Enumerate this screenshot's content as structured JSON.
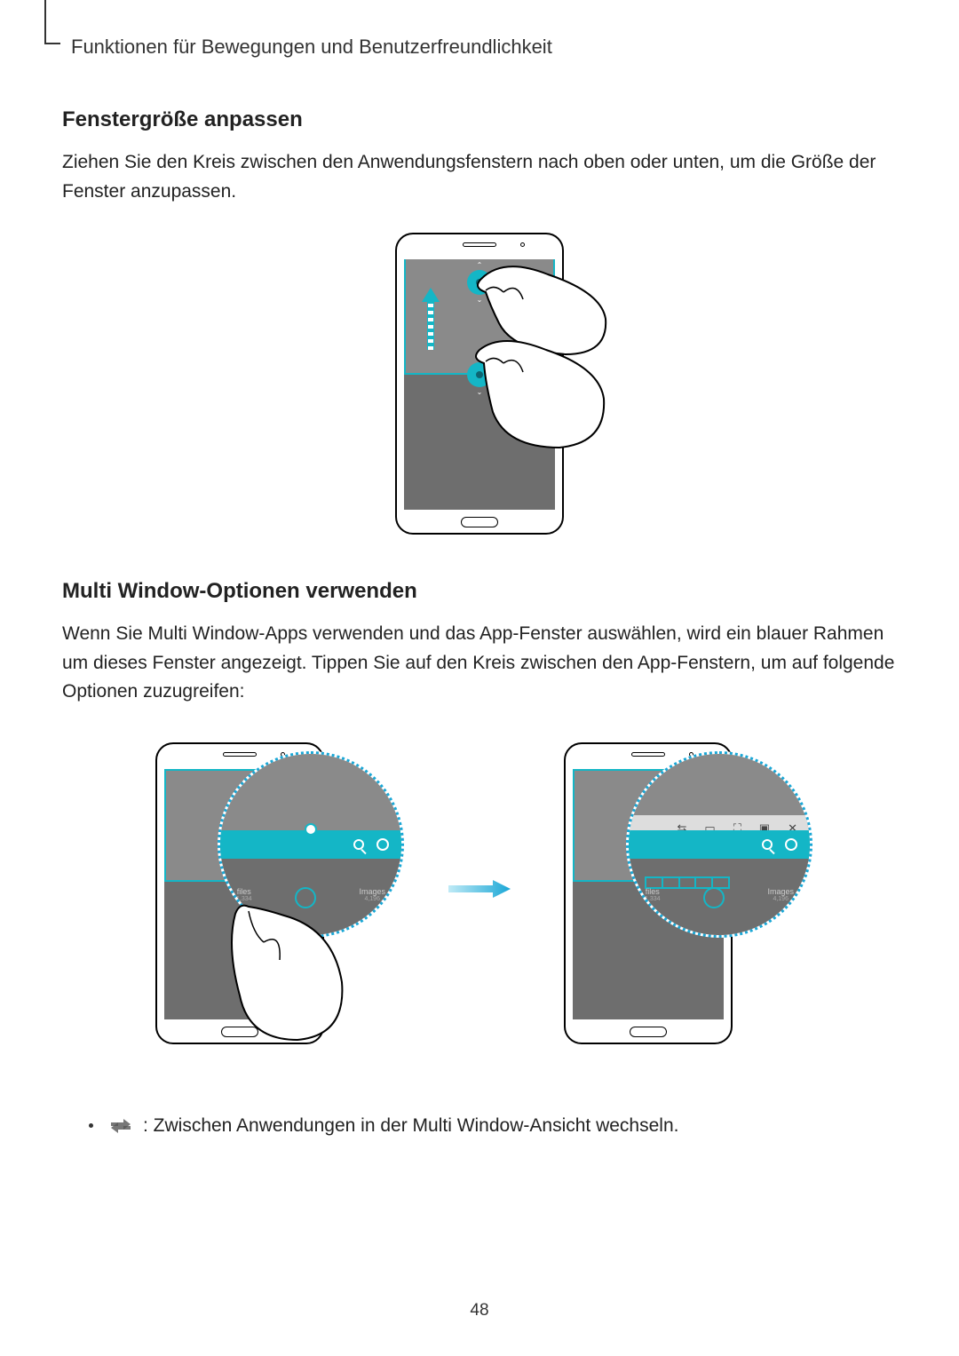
{
  "section_label": "Funktionen für Bewegungen und Benutzerfreundlichkeit",
  "heading1": "Fenstergröße anpassen",
  "para1": "Ziehen Sie den Kreis zwischen den Anwendungsfenstern nach oben oder unten, um die Größe der Fenster anzupassen.",
  "heading2": "Multi Window-Optionen verwenden",
  "para2": "Wenn Sie Multi Window-Apps verwenden und das App-Fenster auswählen, wird ein blauer Rahmen um dieses Fenster angezeigt. Tippen Sie auf den Kreis zwischen den App-Fenstern, um auf folgende Optionen zuzugreifen:",
  "bullet1": ": Zwischen Anwendungen in der Multi Window-Ansicht wechseln.",
  "page_number": "48"
}
